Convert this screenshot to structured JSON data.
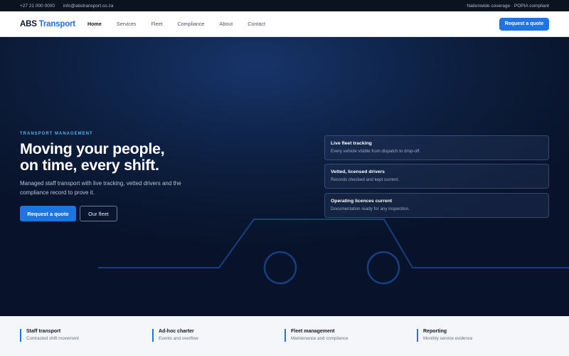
{
  "topbar": {
    "phone": "+27 21 000 0000",
    "email": "info@abstransport.co.za",
    "note": "Nationwide coverage · POPIA compliant"
  },
  "nav": {
    "logo_main": "ABS",
    "logo_accent": "Transport",
    "items": [
      {
        "label": "Home",
        "active": true
      },
      {
        "label": "Services"
      },
      {
        "label": "Fleet"
      },
      {
        "label": "Compliance"
      },
      {
        "label": "About"
      },
      {
        "label": "Contact"
      }
    ],
    "cta": "Request a quote"
  },
  "hero": {
    "eyebrow": "TRANSPORT MANAGEMENT",
    "headline_line1": "Moving your people,",
    "headline_line2": "on time, every shift.",
    "subtitle": "Managed staff transport with live tracking, vetted drivers and the compliance record to prove it.",
    "primary_cta": "Request a quote",
    "secondary_cta": "Our fleet",
    "features": [
      {
        "title": "Live fleet tracking",
        "desc": "Every vehicle visible from dispatch to drop-off."
      },
      {
        "title": "Vetted, licensed drivers",
        "desc": "Records checked and kept current."
      },
      {
        "title": "Operating licences current",
        "desc": "Documentation ready for any inspection."
      }
    ]
  },
  "services": [
    {
      "title": "Staff transport",
      "desc": "Contracted shift movement"
    },
    {
      "title": "Ad-hoc charter",
      "desc": "Events and overflow"
    },
    {
      "title": "Fleet management",
      "desc": "Maintenance and compliance"
    },
    {
      "title": "Reporting",
      "desc": "Monthly service evidence"
    }
  ],
  "colors": {
    "accent": "#1f74e0",
    "hero_bg": "#0b1a36",
    "eyebrow": "#4fb0e8"
  }
}
